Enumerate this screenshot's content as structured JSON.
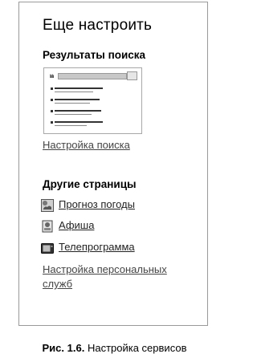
{
  "panel": {
    "title": "Еще настроить",
    "search_results": {
      "heading": "Результаты поиска",
      "settings_link": "Настройка поиска"
    },
    "other_pages": {
      "heading": "Другие страницы",
      "items": [
        {
          "label": "Прогноз погоды",
          "icon": "weather-icon"
        },
        {
          "label": "Афиша",
          "icon": "afisha-icon"
        },
        {
          "label": "Телепрограмма",
          "icon": "tv-icon"
        }
      ],
      "personal_link": "Настройка персональных служб"
    }
  },
  "caption": {
    "number": "Рис. 1.6.",
    "text": "Настройка сервисов"
  }
}
